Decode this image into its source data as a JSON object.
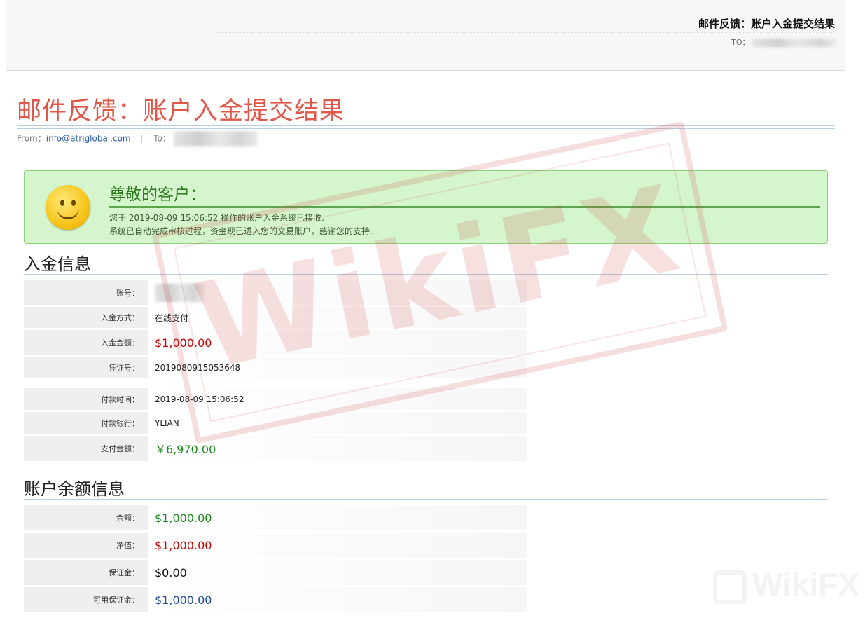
{
  "header": {
    "title": "邮件反馈：账户入金提交结果",
    "to_label": "TO："
  },
  "email": {
    "title": "邮件反馈：账户入金提交结果",
    "from_label": "From：",
    "from_address": "info@atriglobal.com",
    "to_label": "To："
  },
  "notice": {
    "greeting": "尊敬的客户：",
    "line1": "您于 2019-08-09 15:06:52 操作的账户入金系统已接收.",
    "line2": "系统已自动完成审核过程，资金现已进入您的交易账户，感谢您的支持."
  },
  "deposit": {
    "title": "入金信息",
    "rows": [
      {
        "label": "账号：",
        "value": ""
      },
      {
        "label": "入金方式：",
        "value": "在线支付"
      },
      {
        "label": "入金金额：",
        "value": "$1,000.00"
      },
      {
        "label": "凭证号：",
        "value": "2019080915053648"
      }
    ],
    "payment_rows": [
      {
        "label": "付款时间：",
        "value": "2019-08-09 15:06:52"
      },
      {
        "label": "付款银行：",
        "value": "YLIAN"
      },
      {
        "label": "支付金额：",
        "value": "￥6,970.00"
      }
    ]
  },
  "balance": {
    "title": "账户余额信息",
    "rows": [
      {
        "label": "余额：",
        "value": "$1,000.00"
      },
      {
        "label": "净值：",
        "value": "$1,000.00"
      },
      {
        "label": "保证金：",
        "value": "$0.00"
      },
      {
        "label": "可用保证金：",
        "value": "$1,000.00"
      }
    ]
  },
  "watermark": {
    "text": "WikiFX",
    "corner_text": "WikiFX"
  },
  "colors": {
    "title_red": "#e0584a",
    "notice_bg": "#d5f5cd",
    "amount_red": "#cc0000",
    "amount_green": "#1a8a1a",
    "amount_blue": "#1b4f9c"
  }
}
